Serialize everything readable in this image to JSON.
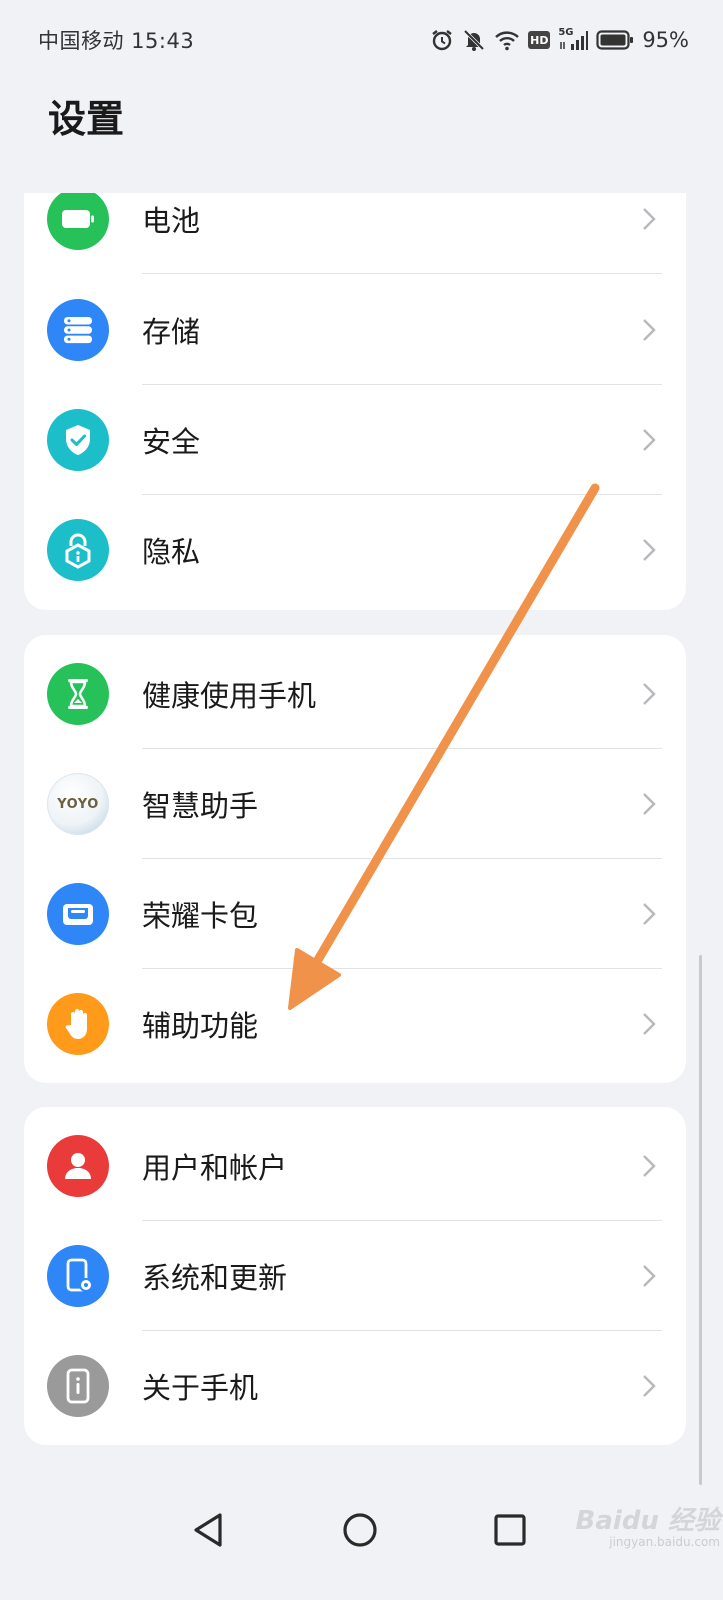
{
  "status_bar": {
    "carrier_time": "中国移动 15:43",
    "network_badge": "HD",
    "network_type": "5G",
    "battery": "95%"
  },
  "page": {
    "title": "设置"
  },
  "groups": [
    {
      "items": [
        {
          "label": "电池",
          "icon": "battery-icon",
          "color": "#27c15a"
        },
        {
          "label": "存储",
          "icon": "storage-icon",
          "color": "#2f86f6"
        },
        {
          "label": "安全",
          "icon": "shield-icon",
          "color": "#1bbec9"
        },
        {
          "label": "隐私",
          "icon": "privacy-lock-icon",
          "color": "#1bbec9"
        }
      ]
    },
    {
      "items": [
        {
          "label": "健康使用手机",
          "icon": "hourglass-icon",
          "color": "#27c15a"
        },
        {
          "label": "智慧助手",
          "icon": "yoyo-assistant-icon",
          "icon_text": "YOYO",
          "color": "#ffffff"
        },
        {
          "label": "荣耀卡包",
          "icon": "wallet-icon",
          "color": "#2f86f6"
        },
        {
          "label": "辅助功能",
          "icon": "hand-icon",
          "color": "#ff9a1a"
        }
      ]
    },
    {
      "items": [
        {
          "label": "用户和帐户",
          "icon": "user-icon",
          "color": "#ea3b3b"
        },
        {
          "label": "系统和更新",
          "icon": "system-update-icon",
          "color": "#2f86f6"
        },
        {
          "label": "关于手机",
          "icon": "about-phone-icon",
          "color": "#9a9a9a"
        }
      ]
    }
  ],
  "annotation": {
    "arrow_color": "#f0924a"
  },
  "watermark": {
    "brand": "Baidu 经验",
    "domain": "jingyan.baidu.com"
  }
}
